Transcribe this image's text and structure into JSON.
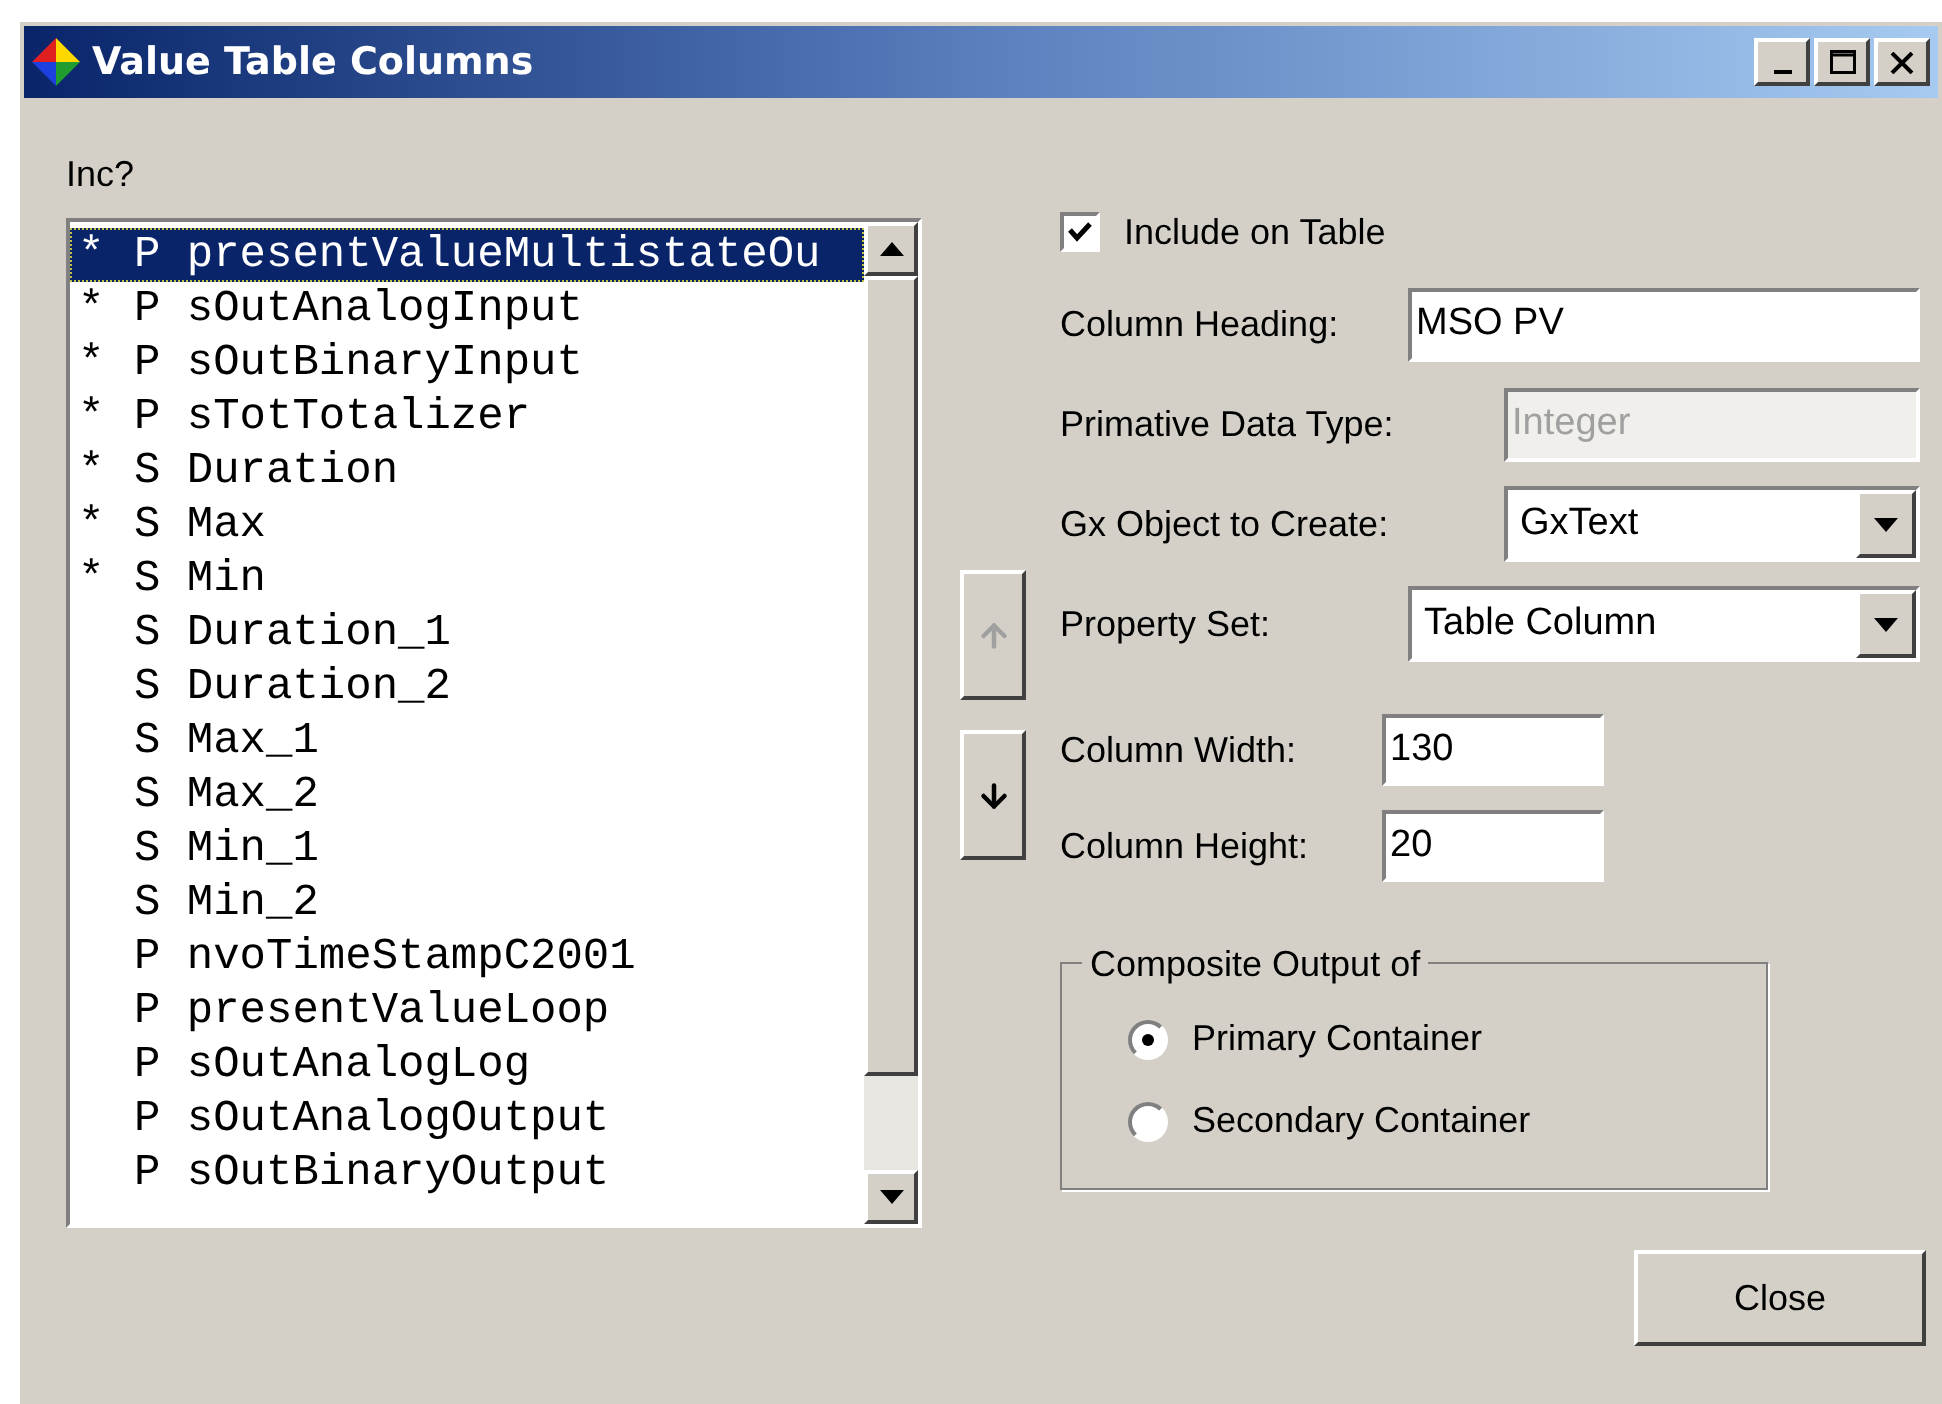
{
  "window": {
    "title": "Value Table Columns"
  },
  "list": {
    "label": "Inc?",
    "items": [
      {
        "mark": "*",
        "text": "P presentValueMultistateOu",
        "selected": true
      },
      {
        "mark": "*",
        "text": "P sOutAnalogInput",
        "selected": false
      },
      {
        "mark": "*",
        "text": "P sOutBinaryInput",
        "selected": false
      },
      {
        "mark": "*",
        "text": "P sTotTotalizer",
        "selected": false
      },
      {
        "mark": "*",
        "text": "S Duration",
        "selected": false
      },
      {
        "mark": "*",
        "text": "S Max",
        "selected": false
      },
      {
        "mark": "*",
        "text": "S Min",
        "selected": false
      },
      {
        "text": "S Duration_1",
        "selected": false
      },
      {
        "text": "S Duration_2",
        "selected": false
      },
      {
        "text": "S Max_1",
        "selected": false
      },
      {
        "text": "S Max_2",
        "selected": false
      },
      {
        "text": "S Min_1",
        "selected": false
      },
      {
        "text": "S Min_2",
        "selected": false
      },
      {
        "text": "P nvoTimeStampC2001",
        "selected": false
      },
      {
        "text": "P presentValueLoop",
        "selected": false
      },
      {
        "text": "P sOutAnalogLog",
        "selected": false
      },
      {
        "text": "P sOutAnalogOutput",
        "selected": false
      },
      {
        "text": "P sOutBinaryOutput",
        "selected": false
      }
    ]
  },
  "move_buttons": [
    {
      "kind": "up",
      "disabled": true
    },
    {
      "kind": "down",
      "disabled": false
    }
  ],
  "include_on_table": {
    "label": "Include on Table",
    "checked": true
  },
  "fields": [
    {
      "kind": "text",
      "label": "Column Heading:",
      "value": "MSO PV",
      "disabled": false
    },
    {
      "kind": "text",
      "label": "Primative Data Type:",
      "value": "Integer",
      "disabled": true
    },
    {
      "kind": "dropdown",
      "label": "Gx Object to Create:",
      "value": "GxText"
    },
    {
      "kind": "dropdown",
      "label": "Property Set:",
      "value": "Table Column"
    }
  ],
  "size_fields": [
    {
      "label": "Column Width:",
      "value": "130"
    },
    {
      "label": "Column Height:",
      "value": "20"
    }
  ],
  "composite_output": {
    "legend": "Composite Output of",
    "options": [
      {
        "label": "Primary Container",
        "selected": true
      },
      {
        "label": "Secondary Container",
        "selected": false
      }
    ]
  },
  "buttons": [
    "Close"
  ]
}
